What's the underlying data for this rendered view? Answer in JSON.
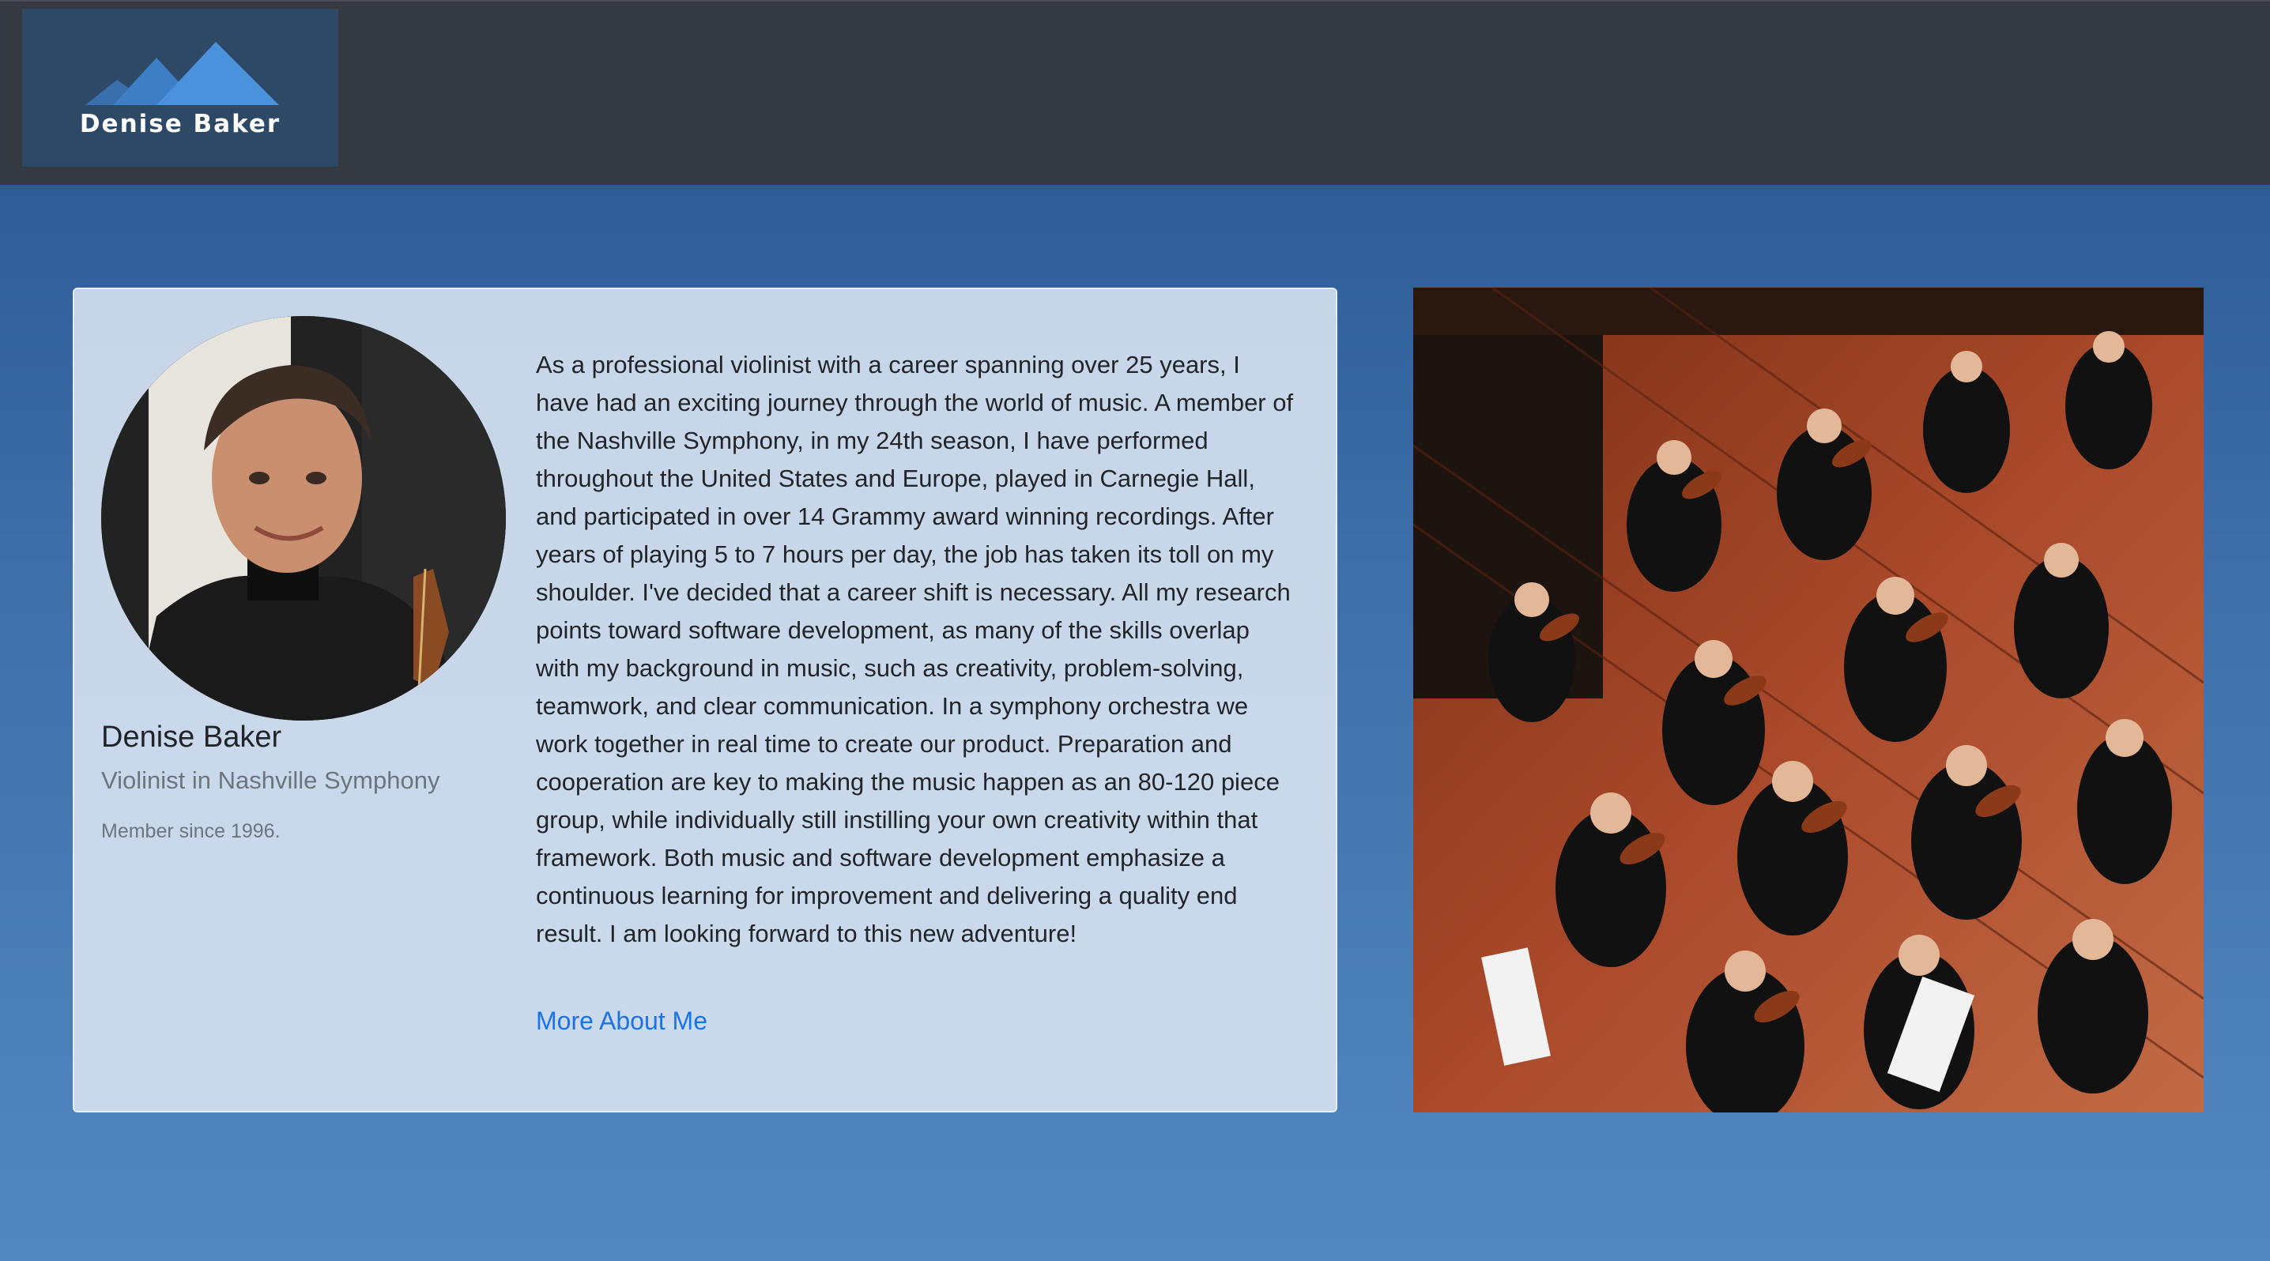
{
  "navbar": {
    "brand_name": "Denise Baker"
  },
  "profile": {
    "name": "Denise Baker",
    "role": "Violinist in Nashville Symphony",
    "member_since": "Member since 1996.",
    "bio": "As a professional violinist with a career spanning over 25 years, I have had an exciting journey through the world of music. A member of the Nashville Symphony, in my 24th season, I have performed throughout the United States and Europe, played in Carnegie Hall, and participated in over 14 Grammy award winning recordings. After years of playing 5 to 7 hours per day, the job has taken its toll on my shoulder. I've decided that a career shift is necessary. All my research points toward software development, as many of the skills overlap with my background in music, such as creativity, problem-solving, teamwork, and clear communication. In a symphony orchestra we work together in real time to create our product. Preparation and cooperation are key to making the music happen as an 80-120 piece group, while individually still instilling your own creativity within that framework. Both music and software development emphasize a continuous learning for improvement and delivering a quality end result. I am looking forward to this new adventure!",
    "more_link": "More About Me"
  },
  "colors": {
    "navbar_bg": "#343a40",
    "page_gradient_top": "#26538f",
    "page_gradient_bottom": "#5288c0",
    "card_bg": "#d0dceb",
    "link": "#1a73e8",
    "muted_text": "#6c757d",
    "logo_mountain": "#4a90d9"
  },
  "images": {
    "logo": "mountain-logo",
    "avatar": "portrait-photo",
    "orchestra": "orchestra-photo"
  }
}
